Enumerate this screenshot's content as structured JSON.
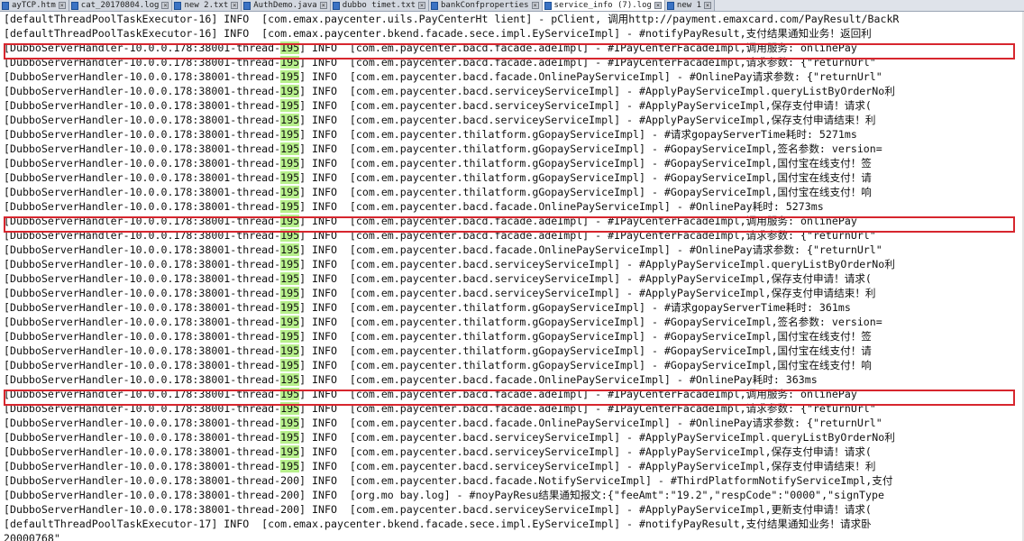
{
  "tabs": [
    {
      "label": "ayTCP.htm",
      "active": false
    },
    {
      "label": "cat_20170804.log",
      "active": false
    },
    {
      "label": "new 2.txt",
      "active": false
    },
    {
      "label": "AuthDemo.java",
      "active": false
    },
    {
      "label": "dubbo timet.txt",
      "active": false
    },
    {
      "label": "bankConfproperties",
      "active": false
    },
    {
      "label": "service_info (7).log",
      "active": true
    },
    {
      "label": "new 1",
      "active": false
    }
  ],
  "thread_highlight": "195",
  "highlight_color": "#b8f08c",
  "box_color": "#d7262e",
  "log_lines": [
    {
      "pre": "[defaultThreadPoolTaskExecutor-16] INFO  [com.emax.paycenter.uils.PayCenterHt lient] - pClient, 调用http://payment.emaxcard.com/PayResult/BackR",
      "hl": "",
      "post": ""
    },
    {
      "pre": "[defaultThreadPoolTaskExecutor-16] INFO  [com.emax.paycenter.bkend.facade.sece.impl.EyServiceImpl] - #notifyPayResult,支付结果通知业务！返回利",
      "hl": "",
      "post": ""
    },
    {
      "pre": "[DubboServerHandler-10.0.0.178:38001-thread-",
      "hl": "195",
      "post": "] INFO  [com.em.paycenter.bacd.facade.adeImpl] - #IPayCenterFacadeImpl,调用服务: onlinePay"
    },
    {
      "pre": "[DubboServerHandler-10.0.0.178:38001-thread-",
      "hl": "195",
      "post": "] INFO  [com.em.paycenter.bacd.facade.adeImpl] - #IPayCenterFacadeImpl,请求参数: {\"returnUrl\""
    },
    {
      "pre": "[DubboServerHandler-10.0.0.178:38001-thread-",
      "hl": "195",
      "post": "] INFO  [com.em.paycenter.bacd.facade.OnlinePayServiceImpl] - #OnlinePay请求参数: {\"returnUrl\""
    },
    {
      "pre": "[DubboServerHandler-10.0.0.178:38001-thread-",
      "hl": "195",
      "post": "] INFO  [com.em.paycenter.bacd.serviceyServiceImpl] - #ApplyPayServiceImpl.queryListByOrderNo利"
    },
    {
      "pre": "[DubboServerHandler-10.0.0.178:38001-thread-",
      "hl": "195",
      "post": "] INFO  [com.em.paycenter.bacd.serviceyServiceImpl] - #ApplyPayServiceImpl,保存支付申请！请求("
    },
    {
      "pre": "[DubboServerHandler-10.0.0.178:38001-thread-",
      "hl": "195",
      "post": "] INFO  [com.em.paycenter.bacd.serviceyServiceImpl] - #ApplyPayServiceImpl,保存支付申请结束！利"
    },
    {
      "pre": "[DubboServerHandler-10.0.0.178:38001-thread-",
      "hl": "195",
      "post": "] INFO  [com.em.paycenter.thilatform.gGopayServiceImpl] - #请求gopayServerTime耗时: 5271ms"
    },
    {
      "pre": "[DubboServerHandler-10.0.0.178:38001-thread-",
      "hl": "195",
      "post": "] INFO  [com.em.paycenter.thilatform.gGopayServiceImpl] - #GopayServiceImpl,签名参数: version="
    },
    {
      "pre": "[DubboServerHandler-10.0.0.178:38001-thread-",
      "hl": "195",
      "post": "] INFO  [com.em.paycenter.thilatform.gGopayServiceImpl] - #GopayServiceImpl,国付宝在线支付！签"
    },
    {
      "pre": "[DubboServerHandler-10.0.0.178:38001-thread-",
      "hl": "195",
      "post": "] INFO  [com.em.paycenter.thilatform.gGopayServiceImpl] - #GopayServiceImpl,国付宝在线支付！请"
    },
    {
      "pre": "[DubboServerHandler-10.0.0.178:38001-thread-",
      "hl": "195",
      "post": "] INFO  [com.em.paycenter.thilatform.gGopayServiceImpl] - #GopayServiceImpl,国付宝在线支付！响"
    },
    {
      "pre": "[DubboServerHandler-10.0.0.178:38001-thread-",
      "hl": "195",
      "post": "] INFO  [com.em.paycenter.bacd.facade.OnlinePayServiceImpl] - #OnlinePay耗时: 5273ms"
    },
    {
      "pre": "[DubboServerHandler-10.0.0.178:38001-thread-",
      "hl": "195",
      "post": "] INFO  [com.em.paycenter.bacd.facade.adeImpl] - #IPayCenterFacadeImpl,调用服务: onlinePay"
    },
    {
      "pre": "[DubboServerHandler-10.0.0.178:38001-thread-",
      "hl": "195",
      "post": "] INFO  [com.em.paycenter.bacd.facade.adeImpl] - #IPayCenterFacadeImpl,请求参数: {\"returnUrl\""
    },
    {
      "pre": "[DubboServerHandler-10.0.0.178:38001-thread-",
      "hl": "195",
      "post": "] INFO  [com.em.paycenter.bacd.facade.OnlinePayServiceImpl] - #OnlinePay请求参数: {\"returnUrl\""
    },
    {
      "pre": "[DubboServerHandler-10.0.0.178:38001-thread-",
      "hl": "195",
      "post": "] INFO  [com.em.paycenter.bacd.serviceyServiceImpl] - #ApplyPayServiceImpl.queryListByOrderNo利"
    },
    {
      "pre": "[DubboServerHandler-10.0.0.178:38001-thread-",
      "hl": "195",
      "post": "] INFO  [com.em.paycenter.bacd.serviceyServiceImpl] - #ApplyPayServiceImpl,保存支付申请！请求("
    },
    {
      "pre": "[DubboServerHandler-10.0.0.178:38001-thread-",
      "hl": "195",
      "post": "] INFO  [com.em.paycenter.bacd.serviceyServiceImpl] - #ApplyPayServiceImpl,保存支付申请结束！利"
    },
    {
      "pre": "[DubboServerHandler-10.0.0.178:38001-thread-",
      "hl": "195",
      "post": "] INFO  [com.em.paycenter.thilatform.gGopayServiceImpl] - #请求gopayServerTime耗时: 361ms"
    },
    {
      "pre": "[DubboServerHandler-10.0.0.178:38001-thread-",
      "hl": "195",
      "post": "] INFO  [com.em.paycenter.thilatform.gGopayServiceImpl] - #GopayServiceImpl,签名参数: version="
    },
    {
      "pre": "[DubboServerHandler-10.0.0.178:38001-thread-",
      "hl": "195",
      "post": "] INFO  [com.em.paycenter.thilatform.gGopayServiceImpl] - #GopayServiceImpl,国付宝在线支付！签"
    },
    {
      "pre": "[DubboServerHandler-10.0.0.178:38001-thread-",
      "hl": "195",
      "post": "] INFO  [com.em.paycenter.thilatform.gGopayServiceImpl] - #GopayServiceImpl,国付宝在线支付！请"
    },
    {
      "pre": "[DubboServerHandler-10.0.0.178:38001-thread-",
      "hl": "195",
      "post": "] INFO  [com.em.paycenter.thilatform.gGopayServiceImpl] - #GopayServiceImpl,国付宝在线支付！响"
    },
    {
      "pre": "[DubboServerHandler-10.0.0.178:38001-thread-",
      "hl": "195",
      "post": "] INFO  [com.em.paycenter.bacd.facade.OnlinePayServiceImpl] - #OnlinePay耗时: 363ms"
    },
    {
      "pre": "[DubboServerHandler-10.0.0.178:38001-thread-",
      "hl": "195",
      "post": "] INFO  [com.em.paycenter.bacd.facade.adeImpl] - #IPayCenterFacadeImpl,调用服务: onlinePay"
    },
    {
      "pre": "[DubboServerHandler-10.0.0.178:38001-thread-",
      "hl": "195",
      "post": "] INFO  [com.em.paycenter.bacd.facade.adeImpl] - #IPayCenterFacadeImpl,请求参数: {\"returnUrl\""
    },
    {
      "pre": "[DubboServerHandler-10.0.0.178:38001-thread-",
      "hl": "195",
      "post": "] INFO  [com.em.paycenter.bacd.facade.OnlinePayServiceImpl] - #OnlinePay请求参数: {\"returnUrl\""
    },
    {
      "pre": "[DubboServerHandler-10.0.0.178:38001-thread-",
      "hl": "195",
      "post": "] INFO  [com.em.paycenter.bacd.serviceyServiceImpl] - #ApplyPayServiceImpl.queryListByOrderNo利"
    },
    {
      "pre": "[DubboServerHandler-10.0.0.178:38001-thread-",
      "hl": "195",
      "post": "] INFO  [com.em.paycenter.bacd.serviceyServiceImpl] - #ApplyPayServiceImpl,保存支付申请！请求("
    },
    {
      "pre": "[DubboServerHandler-10.0.0.178:38001-thread-",
      "hl": "195",
      "post": "] INFO  [com.em.paycenter.bacd.serviceyServiceImpl] - #ApplyPayServiceImpl,保存支付申请结束！利"
    },
    {
      "pre": "[DubboServerHandler-10.0.0.178:38001-thread-200] INFO  [com.em.paycenter.bacd.facade.NotifyServiceImpl] - #ThirdPlatformNotifyServiceImpl,支付",
      "hl": "",
      "post": ""
    },
    {
      "pre": "[DubboServerHandler-10.0.0.178:38001-thread-200] INFO  [org.mo bay.log] - #noyPayResu结果通知报文:{\"feeAmt\":\"19.2\",\"respCode\":\"0000\",\"signType",
      "hl": "",
      "post": ""
    },
    {
      "pre": "[DubboServerHandler-10.0.0.178:38001-thread-200] INFO  [com.em.paycenter.bacd.serviceyServiceImpl] - #ApplyPayServiceImpl,更新支付申请！请求(",
      "hl": "",
      "post": ""
    },
    {
      "pre": "[defaultThreadPoolTaskExecutor-17] INFO  [com.emax.paycenter.bkend.facade.sece.impl.EyServiceImpl] - #notifyPayResult,支付结果通知业务！请求卧",
      "hl": "",
      "post": ""
    },
    {
      "pre": "20000768\"",
      "hl": "",
      "post": ""
    }
  ]
}
